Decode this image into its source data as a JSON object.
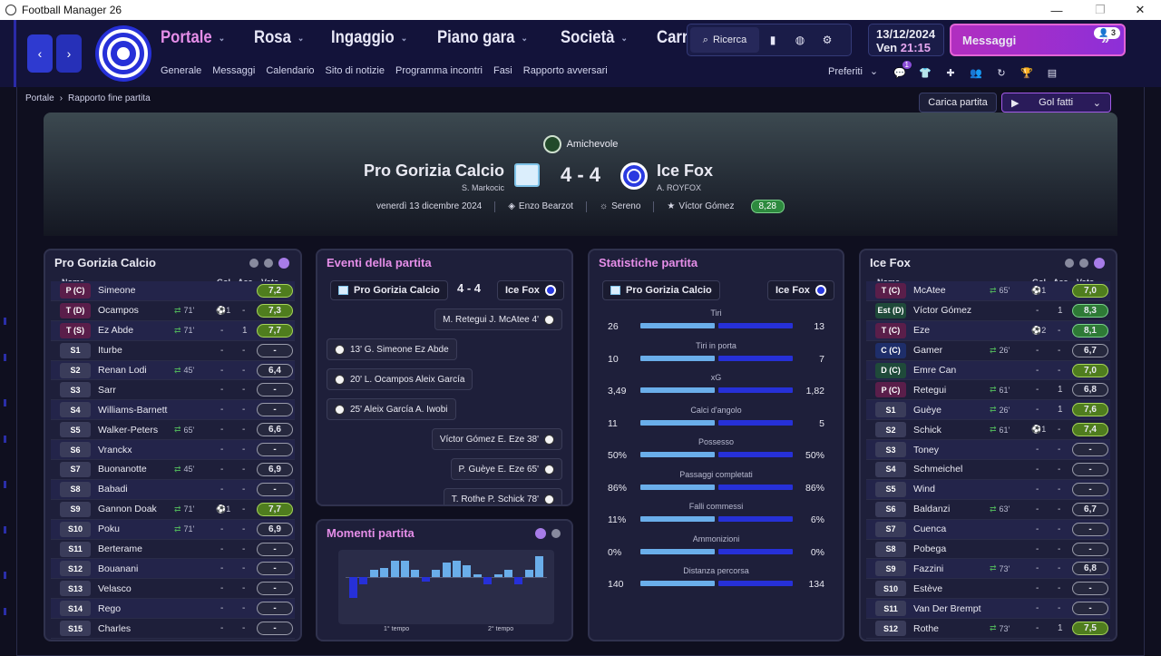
{
  "window": {
    "title": "Football Manager 26",
    "min": "—",
    "max": "❐",
    "close": "✕"
  },
  "nav": {
    "back": "‹",
    "forward": "›",
    "menu": [
      {
        "label": "Portale",
        "active": true
      },
      {
        "label": "Rosa"
      },
      {
        "label": "Ingaggio"
      },
      {
        "label": "Piano gara"
      },
      {
        "label": "Società"
      },
      {
        "label": "Carriera"
      }
    ],
    "submenu": [
      "Generale",
      "Messaggi",
      "Calendario",
      "Sito di notizie",
      "Programma incontri",
      "Fasi",
      "Rapporto avversari"
    ],
    "search_label": "Ricerca",
    "date": "13/12/2024",
    "day": "Ven",
    "time": "21:15",
    "messages_label": "Messaggi",
    "messages_count": "3",
    "favorites_label": "Preferiti",
    "quick_badge": "1",
    "quick_icons": [
      "chat-icon",
      "shirt-icon",
      "medical-icon",
      "users-icon",
      "refresh-icon",
      "trophy-icon",
      "calendar-icon"
    ]
  },
  "breadcrumb": {
    "root": "Portale",
    "current": "Rapporto fine partita"
  },
  "actions": {
    "load_match": "Carica partita",
    "goals": "Gol fatti"
  },
  "match": {
    "competition": "Amichevole",
    "home": {
      "name": "Pro Gorizia Calcio",
      "manager": "S. Markocic"
    },
    "away": {
      "name": "Ice Fox",
      "manager": "A. ROYFOX"
    },
    "score": "4 - 4",
    "date": "venerdì 13 dicembre 2024",
    "referee": "Enzo Bearzot",
    "weather": "Sereno",
    "motm": "Víctor Gómez",
    "motm_rating": "8,28"
  },
  "home_panel": {
    "title": "Pro Gorizia Calcio",
    "cols": {
      "name": "Nome",
      "gol": "Gol",
      "ass": "Ass",
      "vote": "Voto"
    },
    "players": [
      {
        "pos": "P (C)",
        "name": "Simeone",
        "sub": "",
        "gol": "",
        "ass": "",
        "vote": "7,2",
        "tone": "lime",
        "pcls": "att"
      },
      {
        "pos": "T (D)",
        "name": "Ocampos",
        "sub": "71'",
        "gol": "1",
        "ass": "-",
        "vote": "7,3",
        "tone": "lime",
        "pcls": "att"
      },
      {
        "pos": "T (S)",
        "name": "Ez Abde",
        "sub": "71'",
        "gol": "-",
        "ass": "1",
        "vote": "7,7",
        "tone": "lime",
        "pcls": "att"
      },
      {
        "pos": "S1",
        "name": "Iturbe",
        "sub": "",
        "gol": "-",
        "ass": "-",
        "vote": "-",
        "tone": "dark",
        "pcls": ""
      },
      {
        "pos": "S2",
        "name": "Renan Lodi",
        "sub": "45'",
        "gol": "-",
        "ass": "-",
        "vote": "6,4",
        "tone": "dark",
        "pcls": ""
      },
      {
        "pos": "S3",
        "name": "Sarr",
        "sub": "",
        "gol": "-",
        "ass": "-",
        "vote": "-",
        "tone": "dark",
        "pcls": ""
      },
      {
        "pos": "S4",
        "name": "Williams-Barnett",
        "sub": "",
        "gol": "-",
        "ass": "-",
        "vote": "-",
        "tone": "dark",
        "pcls": ""
      },
      {
        "pos": "S5",
        "name": "Walker-Peters",
        "sub": "65'",
        "gol": "-",
        "ass": "-",
        "vote": "6,6",
        "tone": "dark",
        "pcls": ""
      },
      {
        "pos": "S6",
        "name": "Vranckx",
        "sub": "",
        "gol": "-",
        "ass": "-",
        "vote": "-",
        "tone": "dark",
        "pcls": ""
      },
      {
        "pos": "S7",
        "name": "Buonanotte",
        "sub": "45'",
        "gol": "-",
        "ass": "-",
        "vote": "6,9",
        "tone": "dark",
        "pcls": ""
      },
      {
        "pos": "S8",
        "name": "Babadi",
        "sub": "",
        "gol": "-",
        "ass": "-",
        "vote": "-",
        "tone": "dark",
        "pcls": ""
      },
      {
        "pos": "S9",
        "name": "Gannon Doak",
        "sub": "71'",
        "gol": "1",
        "ass": "-",
        "vote": "7,7",
        "tone": "lime",
        "pcls": ""
      },
      {
        "pos": "S10",
        "name": "Poku",
        "sub": "71'",
        "gol": "-",
        "ass": "-",
        "vote": "6,9",
        "tone": "dark",
        "pcls": ""
      },
      {
        "pos": "S11",
        "name": "Berterame",
        "sub": "",
        "gol": "-",
        "ass": "-",
        "vote": "-",
        "tone": "dark",
        "pcls": ""
      },
      {
        "pos": "S12",
        "name": "Bouanani",
        "sub": "",
        "gol": "-",
        "ass": "-",
        "vote": "-",
        "tone": "dark",
        "pcls": ""
      },
      {
        "pos": "S13",
        "name": "Velasco",
        "sub": "",
        "gol": "-",
        "ass": "-",
        "vote": "-",
        "tone": "dark",
        "pcls": ""
      },
      {
        "pos": "S14",
        "name": "Rego",
        "sub": "",
        "gol": "-",
        "ass": "-",
        "vote": "-",
        "tone": "dark",
        "pcls": ""
      },
      {
        "pos": "S15",
        "name": "Charles",
        "sub": "",
        "gol": "-",
        "ass": "-",
        "vote": "-",
        "tone": "dark",
        "pcls": ""
      }
    ]
  },
  "away_panel": {
    "title": "Ice Fox",
    "cols": {
      "name": "Nome",
      "gol": "Gol",
      "ass": "Ass",
      "vote": "Voto"
    },
    "players": [
      {
        "pos": "T (C)",
        "name": "McAtee",
        "sub": "65'",
        "gol": "1",
        "ass": "",
        "vote": "7,0",
        "tone": "lime",
        "pcls": "att"
      },
      {
        "pos": "Est (D)",
        "name": "Víctor Gómez",
        "sub": "",
        "gol": "-",
        "ass": "1",
        "vote": "8,3",
        "tone": "green",
        "pcls": "def"
      },
      {
        "pos": "T (C)",
        "name": "Eze",
        "sub": "",
        "gol": "2",
        "ass": "-",
        "vote": "8,1",
        "tone": "green",
        "pcls": "att"
      },
      {
        "pos": "C (C)",
        "name": "Gamer",
        "sub": "26'",
        "gol": "-",
        "ass": "-",
        "vote": "6,7",
        "tone": "dark",
        "pcls": "mid"
      },
      {
        "pos": "D (C)",
        "name": "Emre Can",
        "sub": "",
        "gol": "-",
        "ass": "-",
        "vote": "7,0",
        "tone": "lime",
        "pcls": "def"
      },
      {
        "pos": "P (C)",
        "name": "Retegui",
        "sub": "61'",
        "gol": "-",
        "ass": "1",
        "vote": "6,8",
        "tone": "dark",
        "pcls": "att"
      },
      {
        "pos": "S1",
        "name": "Guèye",
        "sub": "26'",
        "gol": "-",
        "ass": "1",
        "vote": "7,6",
        "tone": "lime",
        "pcls": ""
      },
      {
        "pos": "S2",
        "name": "Schick",
        "sub": "61'",
        "gol": "1",
        "ass": "-",
        "vote": "7,4",
        "tone": "lime",
        "pcls": ""
      },
      {
        "pos": "S3",
        "name": "Toney",
        "sub": "",
        "gol": "-",
        "ass": "-",
        "vote": "-",
        "tone": "dark",
        "pcls": ""
      },
      {
        "pos": "S4",
        "name": "Schmeichel",
        "sub": "",
        "gol": "-",
        "ass": "-",
        "vote": "-",
        "tone": "dark",
        "pcls": ""
      },
      {
        "pos": "S5",
        "name": "Wind",
        "sub": "",
        "gol": "-",
        "ass": "-",
        "vote": "-",
        "tone": "dark",
        "pcls": ""
      },
      {
        "pos": "S6",
        "name": "Baldanzi",
        "sub": "63'",
        "gol": "-",
        "ass": "-",
        "vote": "6,7",
        "tone": "dark",
        "pcls": ""
      },
      {
        "pos": "S7",
        "name": "Cuenca",
        "sub": "",
        "gol": "-",
        "ass": "-",
        "vote": "-",
        "tone": "dark",
        "pcls": ""
      },
      {
        "pos": "S8",
        "name": "Pobega",
        "sub": "",
        "gol": "-",
        "ass": "-",
        "vote": "-",
        "tone": "dark",
        "pcls": ""
      },
      {
        "pos": "S9",
        "name": "Fazzini",
        "sub": "73'",
        "gol": "-",
        "ass": "-",
        "vote": "6,8",
        "tone": "dark",
        "pcls": ""
      },
      {
        "pos": "S10",
        "name": "Estève",
        "sub": "",
        "gol": "-",
        "ass": "-",
        "vote": "-",
        "tone": "dark",
        "pcls": ""
      },
      {
        "pos": "S11",
        "name": "Van Der Brempt",
        "sub": "",
        "gol": "-",
        "ass": "-",
        "vote": "-",
        "tone": "dark",
        "pcls": ""
      },
      {
        "pos": "S12",
        "name": "Rothe",
        "sub": "73'",
        "gol": "-",
        "ass": "1",
        "vote": "7,5",
        "tone": "lime",
        "pcls": ""
      }
    ]
  },
  "events": {
    "title": "Eventi della partita",
    "home": "Pro Gorizia Calcio",
    "score": "4 - 4",
    "away": "Ice Fox",
    "items": [
      {
        "side": "away",
        "text": "M. Retegui  J. McAtee  4'"
      },
      {
        "side": "home",
        "text": "13'  G. Simeone  Ez Abde"
      },
      {
        "side": "home",
        "text": "20'  L. Ocampos  Aleix García"
      },
      {
        "side": "home",
        "text": "25'  Aleix García  A. Iwobi"
      },
      {
        "side": "away",
        "text": "Víctor Gómez  E. Eze  38'"
      },
      {
        "side": "away",
        "text": "P. Guèye  E. Eze  65'"
      },
      {
        "side": "away",
        "text": "T. Rothe  P. Schick  78'"
      }
    ]
  },
  "moments": {
    "title": "Momenti partita",
    "half1": "1° tempo",
    "half2": "2° tempo",
    "values": [
      -0.9,
      -0.3,
      0.3,
      0.4,
      0.7,
      0.7,
      0.3,
      -0.2,
      0.3,
      0.6,
      0.7,
      0.5,
      0.1,
      -0.3,
      0.1,
      0.3,
      -0.3,
      0.3,
      0.9
    ]
  },
  "stats": {
    "title": "Statistiche partita",
    "home": "Pro Gorizia Calcio",
    "away": "Ice Fox",
    "rows": [
      {
        "label": "Tiri",
        "home": "26",
        "away": "13",
        "h": 26,
        "a": 13
      },
      {
        "label": "Tiri in porta",
        "home": "10",
        "away": "7",
        "h": 10,
        "a": 7
      },
      {
        "label": "xG",
        "home": "3,49",
        "away": "1,82",
        "h": 3.49,
        "a": 1.82
      },
      {
        "label": "Calci d'angolo",
        "home": "11",
        "away": "5",
        "h": 11,
        "a": 5
      },
      {
        "label": "Possesso",
        "home": "50%",
        "away": "50%",
        "h": 50,
        "a": 50
      },
      {
        "label": "Passaggi completati",
        "home": "86%",
        "away": "86%",
        "h": 86,
        "a": 86
      },
      {
        "label": "Falli commessi",
        "home": "11%",
        "away": "6%",
        "h": 11,
        "a": 6
      },
      {
        "label": "Ammonizioni",
        "home": "0%",
        "away": "0%",
        "h": 0,
        "a": 0
      },
      {
        "label": "Distanza percorsa",
        "home": "140",
        "away": "134",
        "h": 140,
        "a": 134
      }
    ]
  }
}
